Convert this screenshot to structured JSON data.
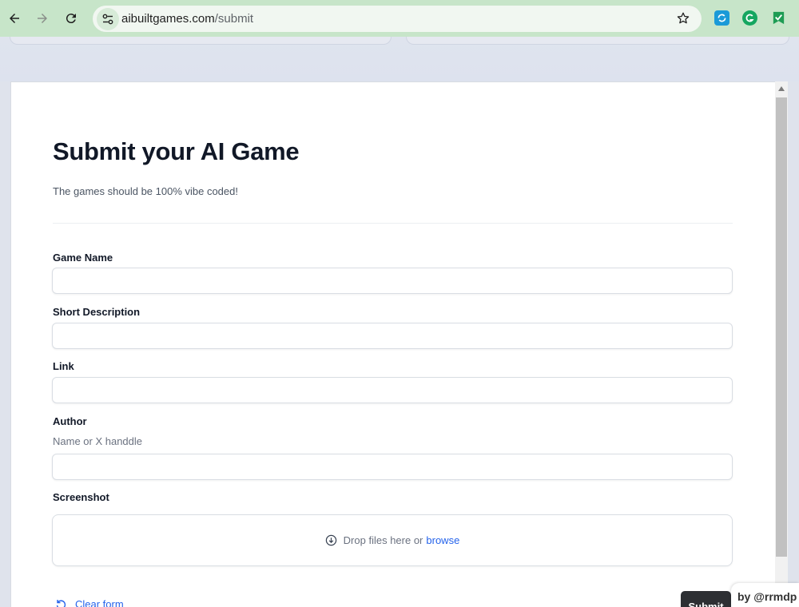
{
  "browser": {
    "url_host": "aibuiltgames.com",
    "url_path": "/submit"
  },
  "page": {
    "title": "Submit your AI Game",
    "subtitle": "The games should be 100% vibe coded!"
  },
  "form": {
    "game_name": {
      "label": "Game Name",
      "value": "",
      "placeholder": ""
    },
    "short_description": {
      "label": "Short Description",
      "value": "",
      "placeholder": ""
    },
    "link": {
      "label": "Link",
      "value": "",
      "placeholder": ""
    },
    "author": {
      "label": "Author",
      "hint": "Name or X handdle",
      "value": "",
      "placeholder": ""
    },
    "screenshot": {
      "label": "Screenshot",
      "drop_text": "Drop files here or",
      "browse_text": "browse"
    },
    "clear_label": "Clear form",
    "submit_label": "Submit"
  },
  "credit": "by @rrmdp",
  "colors": {
    "toolbar": "#c7e5c9",
    "link": "#2563eb",
    "submit_bg": "#2d2f33"
  }
}
